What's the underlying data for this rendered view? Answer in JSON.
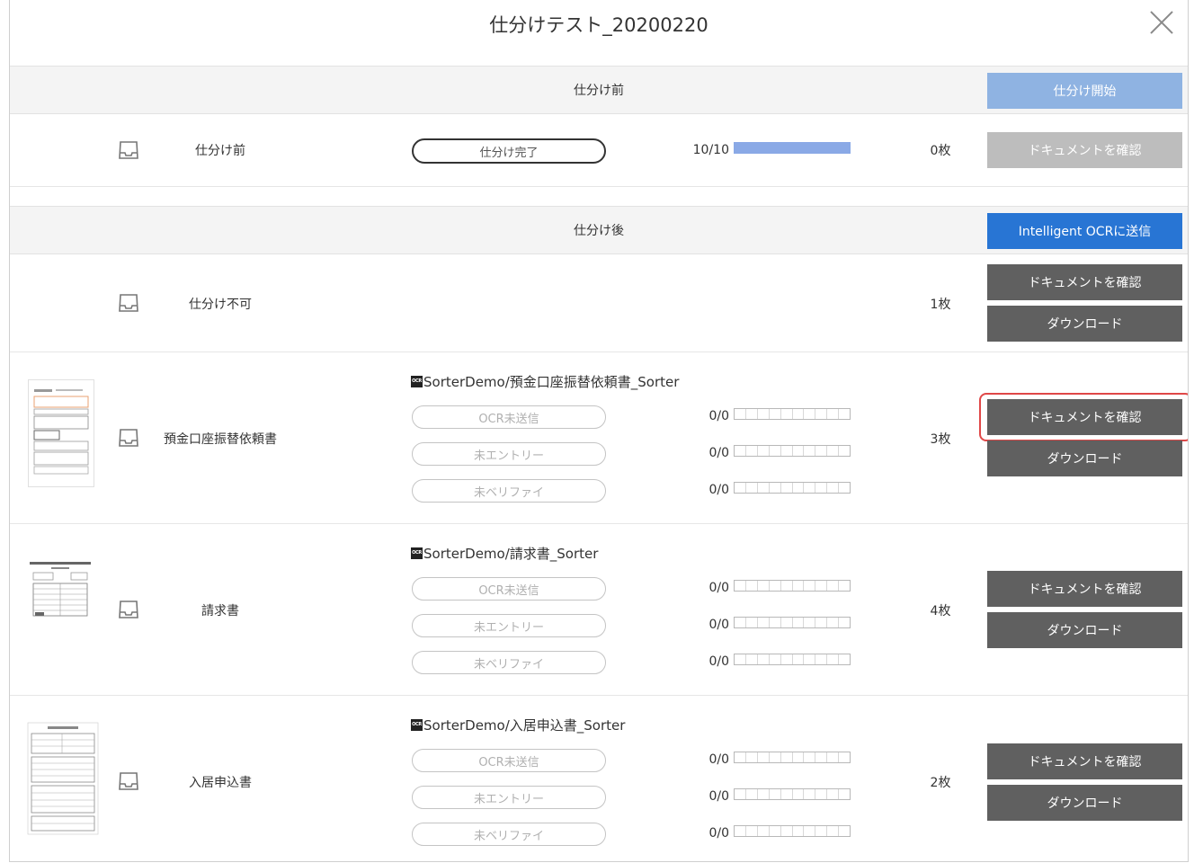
{
  "title": "仕分けテスト_20200220",
  "before_section": {
    "header": "仕分け前",
    "start_button": "仕分け開始",
    "row": {
      "label": "仕分け前",
      "status": "仕分け完了",
      "progress_text": "10/10",
      "progress": 1.0,
      "count": "0枚",
      "confirm_button": "ドキュメントを確認"
    }
  },
  "after_section": {
    "header": "仕分け後",
    "send_button": "Intelligent OCRに送信",
    "unsortable": {
      "label": "仕分け不可",
      "count": "1枚",
      "confirm_button": "ドキュメントを確認",
      "download_button": "ダウンロード"
    },
    "forms": [
      {
        "label": "預金口座振替依頼書",
        "form_title": "SorterDemo/預金口座振替依頼書_Sorter",
        "count": "3枚",
        "statuses": [
          {
            "label": "OCR未送信",
            "progress_text": "0/0"
          },
          {
            "label": "未エントリー",
            "progress_text": "0/0"
          },
          {
            "label": "未ベリファイ",
            "progress_text": "0/0"
          }
        ],
        "confirm_button": "ドキュメントを確認",
        "download_button": "ダウンロード"
      },
      {
        "label": "請求書",
        "form_title": "SorterDemo/請求書_Sorter",
        "count": "4枚",
        "statuses": [
          {
            "label": "OCR未送信",
            "progress_text": "0/0"
          },
          {
            "label": "未エントリー",
            "progress_text": "0/0"
          },
          {
            "label": "未ベリファイ",
            "progress_text": "0/0"
          }
        ],
        "confirm_button": "ドキュメントを確認",
        "download_button": "ダウンロード"
      },
      {
        "label": "入居申込書",
        "form_title": "SorterDemo/入居申込書_Sorter",
        "count": "2枚",
        "statuses": [
          {
            "label": "OCR未送信",
            "progress_text": "0/0"
          },
          {
            "label": "未エントリー",
            "progress_text": "0/0"
          },
          {
            "label": "未ベリファイ",
            "progress_text": "0/0"
          }
        ],
        "confirm_button": "ドキュメントを確認",
        "download_button": "ダウンロード"
      }
    ]
  },
  "ocr_badge_text": "OCR",
  "icons": {
    "close": "close-icon",
    "tray": "tray-icon",
    "badge": "ocr-badge-icon"
  },
  "colors": {
    "dark_button": "#606060",
    "disabled_button": "#bdbdbd",
    "start_button": "#8fb3e2",
    "send_button": "#2875d4",
    "progress_fill": "#8aa9e6",
    "highlight": "#e04848"
  }
}
